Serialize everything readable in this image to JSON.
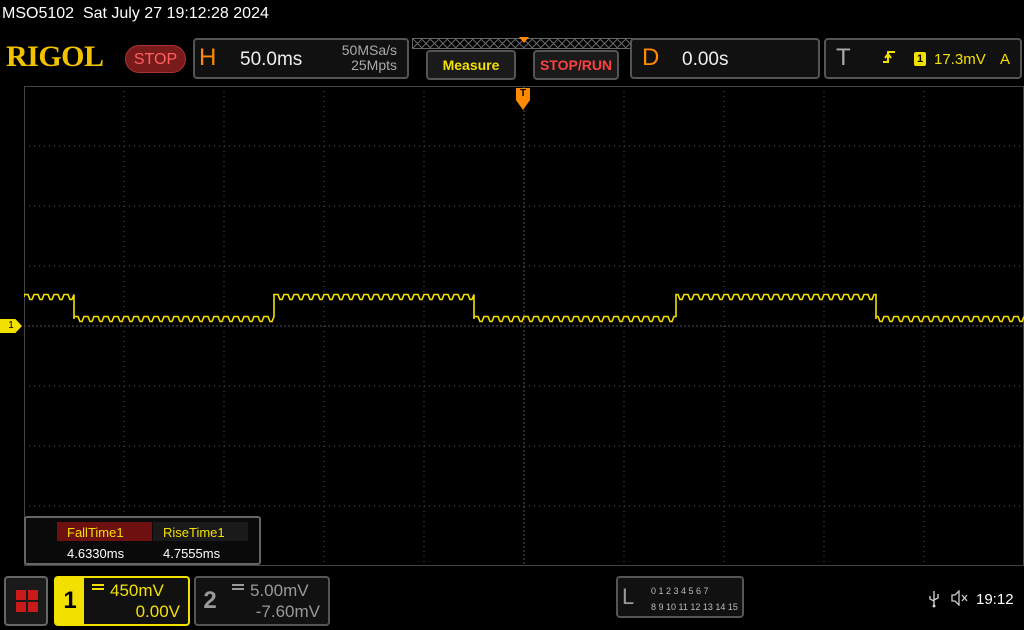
{
  "titlebar": {
    "model": "MSO5102",
    "datetime": "Sat July 27 19:12:28 2024"
  },
  "brand": {
    "logo": "RIGOL",
    "run_state": "STOP"
  },
  "horizontal": {
    "letter": "H",
    "timebase": "50.0ms",
    "sample_rate": "50MSa/s",
    "memory_depth": "25Mpts"
  },
  "buttons": {
    "measure": "Measure",
    "stop_run": "STOP/RUN"
  },
  "delay": {
    "letter": "D",
    "value": "0.00s"
  },
  "trigger": {
    "letter": "T",
    "edge_icon": "rising-edge-icon",
    "source": "1",
    "level": "17.3mV",
    "mode": "A"
  },
  "markers": {
    "ch1": "1",
    "trigger_pos": "T"
  },
  "measurements": [
    {
      "label": "FallTime1",
      "value": "4.6330ms"
    },
    {
      "label": "RiseTime1",
      "value": "4.7555ms"
    }
  ],
  "channels": [
    {
      "num": "1",
      "scale": "450mV",
      "offset": "0.00V",
      "color": "#f2e000"
    },
    {
      "num": "2",
      "scale": "5.00mV",
      "offset": "-7.60mV",
      "color": "#999999"
    }
  ],
  "logic_analyzer": {
    "letter": "L",
    "row1": "0 1 2 3  4 5 6 7",
    "row2": "8 9 10 11 12 13 14 15"
  },
  "status": {
    "time": "19:12"
  },
  "colors": {
    "trace": "#f2e000",
    "accent": "#ff8a00",
    "grid": "#444444"
  }
}
